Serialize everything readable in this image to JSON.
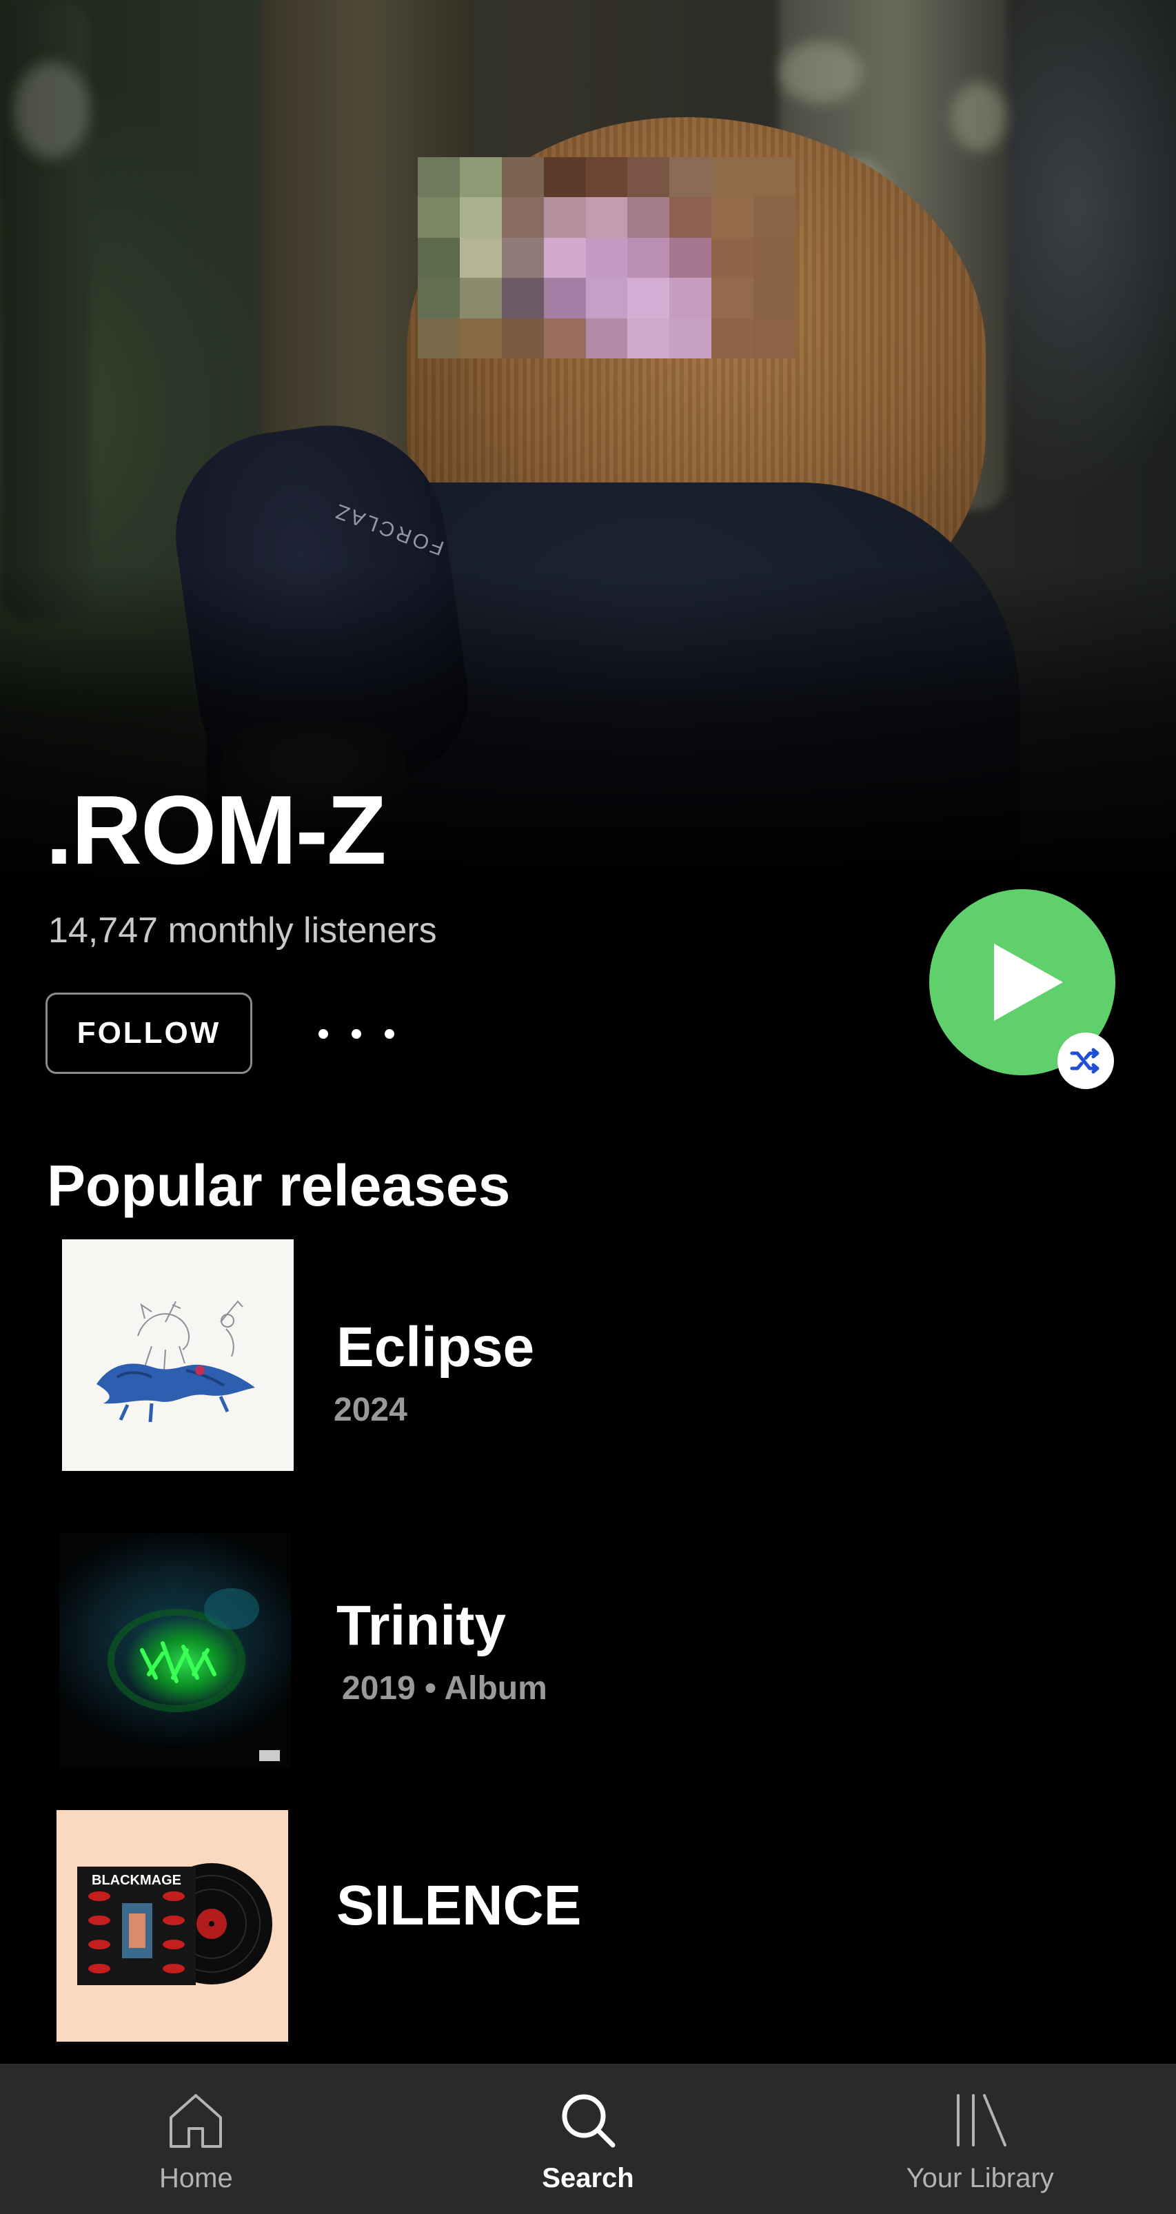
{
  "artist": {
    "name": ".ROM-Z",
    "monthly_listeners": "14,747 monthly listeners",
    "follow_label": "FOLLOW"
  },
  "hero": {
    "glove_brand": "FORCLAZ"
  },
  "colors": {
    "accent_green": "#5fd06c",
    "background": "#000000",
    "nav_background": "#2a2a2a",
    "shuffle_icon": "#1f4fd6"
  },
  "popular_releases": {
    "heading": "Popular releases",
    "items": [
      {
        "title": "Eclipse",
        "subtitle": "2024"
      },
      {
        "title": "Trinity",
        "subtitle": "2019 • Album"
      },
      {
        "title": "SILENCE",
        "subtitle": "",
        "cover_text": "BLACKMAGE"
      }
    ]
  },
  "bottom_nav": {
    "items": [
      {
        "label": "Home",
        "icon": "home-icon",
        "active": false
      },
      {
        "label": "Search",
        "icon": "search-icon",
        "active": true
      },
      {
        "label": "Your Library",
        "icon": "library-icon",
        "active": false
      }
    ]
  }
}
